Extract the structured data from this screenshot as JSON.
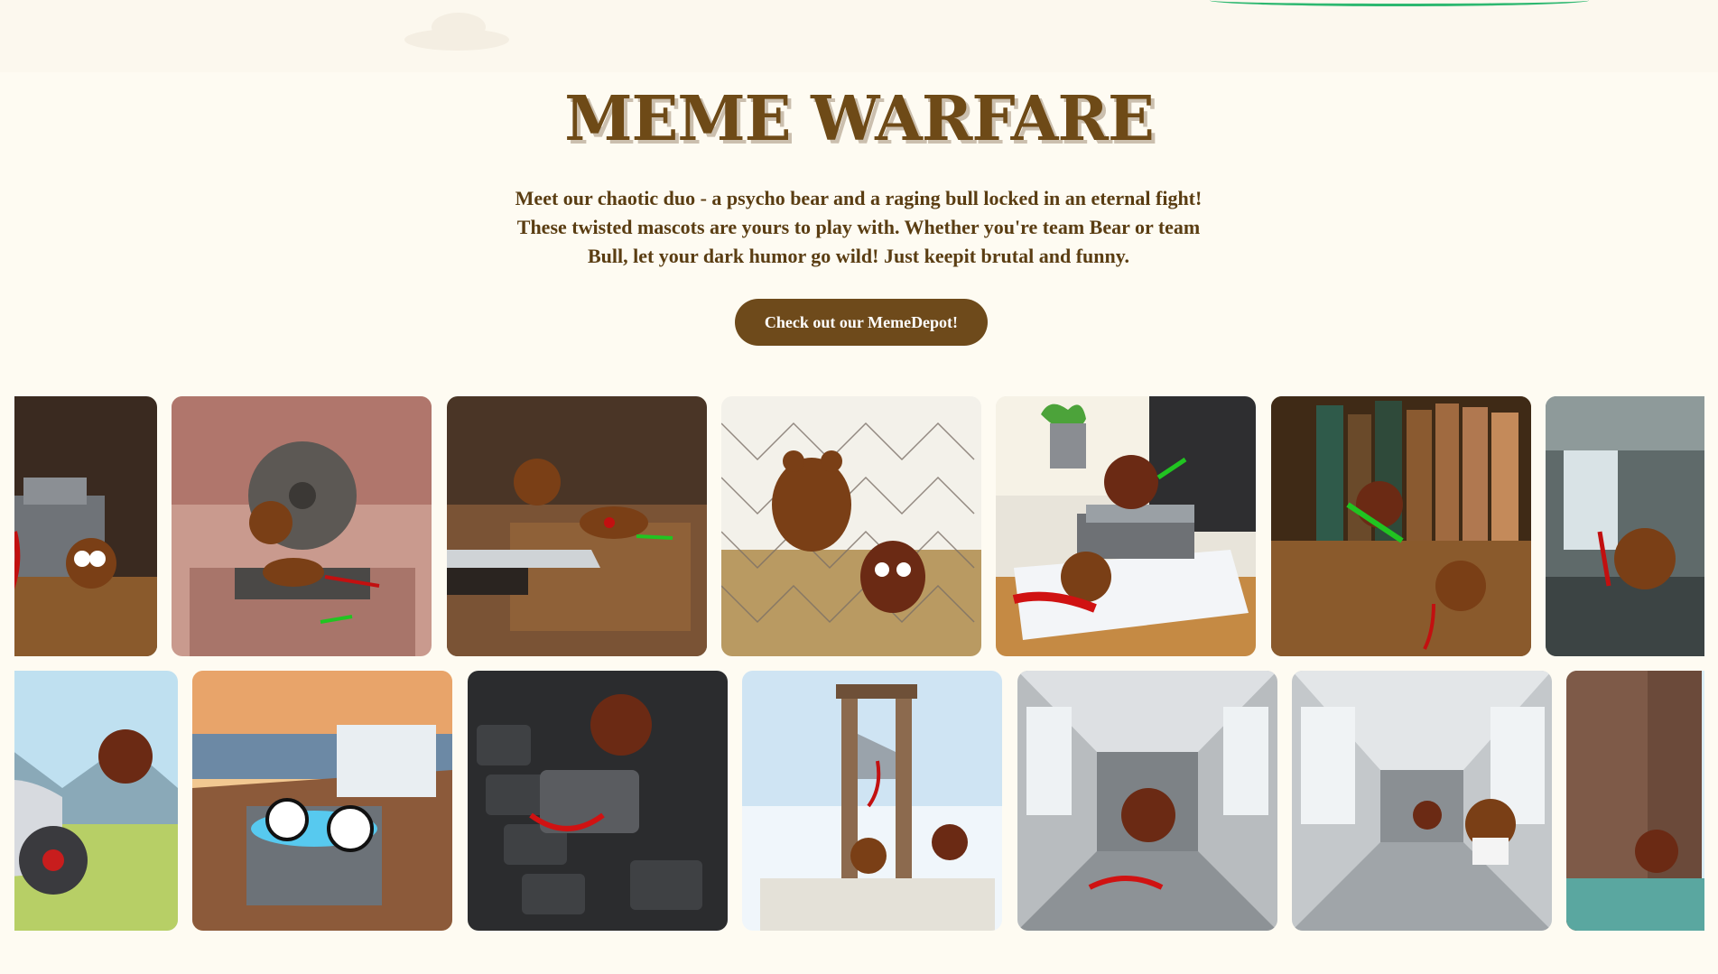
{
  "hero": {
    "title": "MEME WARFARE",
    "description": "Meet our chaotic duo - a psycho bear and a raging bull locked in an eternal fight! These twisted mascots are yours to play with. Whether you're team Bear or team Bull, let your dark humor go wild! Just keepit brutal and funny.",
    "cta_label": "Check out our MemeDepot!"
  },
  "gallery": {
    "row1": [
      {
        "scene": "vise-workbench"
      },
      {
        "scene": "miter-saw"
      },
      {
        "scene": "knife-cutting-board"
      },
      {
        "scene": "electric-fence"
      },
      {
        "scene": "stapler-desk"
      },
      {
        "scene": "bookshelf"
      },
      {
        "scene": "abandoned-corridor"
      }
    ],
    "row2": [
      {
        "scene": "motorcycle-meadow"
      },
      {
        "scene": "yacht-hot-tub"
      },
      {
        "scene": "keyboard-enter-key"
      },
      {
        "scene": "guillotine"
      },
      {
        "scene": "subway-car"
      },
      {
        "scene": "subway-car-reading"
      },
      {
        "scene": "waterfall-cliff"
      }
    ]
  },
  "colors": {
    "page_bg": "#fefbf2",
    "title": "#6e4a17",
    "text": "#5a3d12",
    "button_bg": "#6e4a1b",
    "button_text": "#ffffff",
    "accent_green": "#2db870"
  }
}
